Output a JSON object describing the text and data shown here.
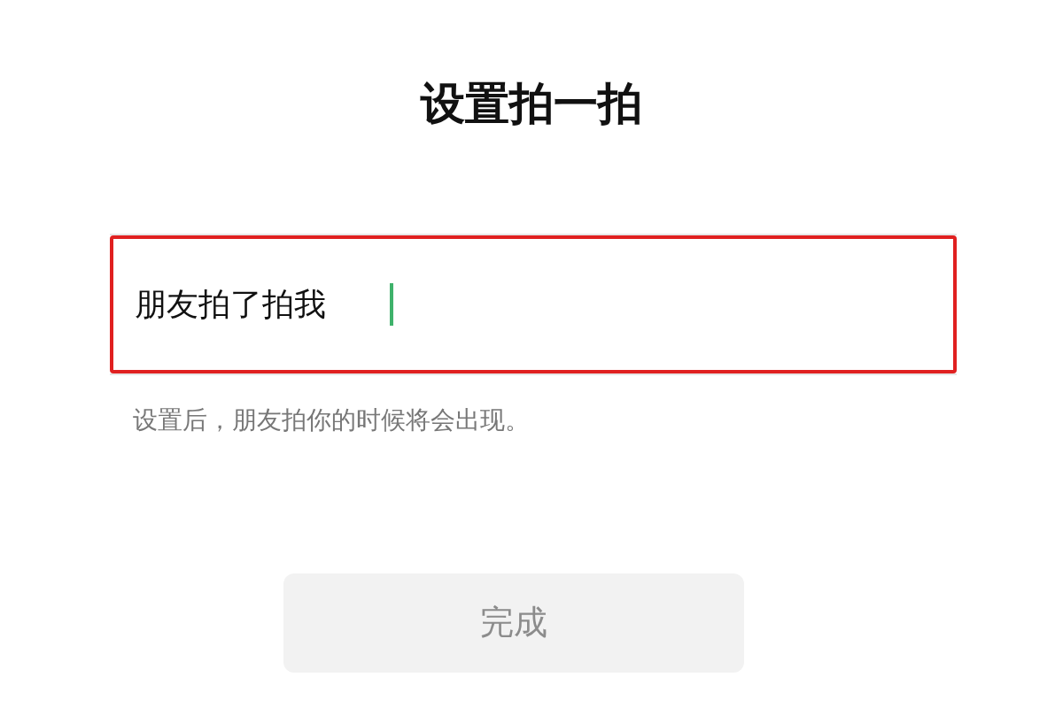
{
  "title": "设置拍一拍",
  "field": {
    "value": "朋友拍了拍我",
    "focused": true,
    "highlighted": true
  },
  "hint": "设置后，朋友拍你的时候将会出现。",
  "button": {
    "label": "完成",
    "disabled": true
  }
}
